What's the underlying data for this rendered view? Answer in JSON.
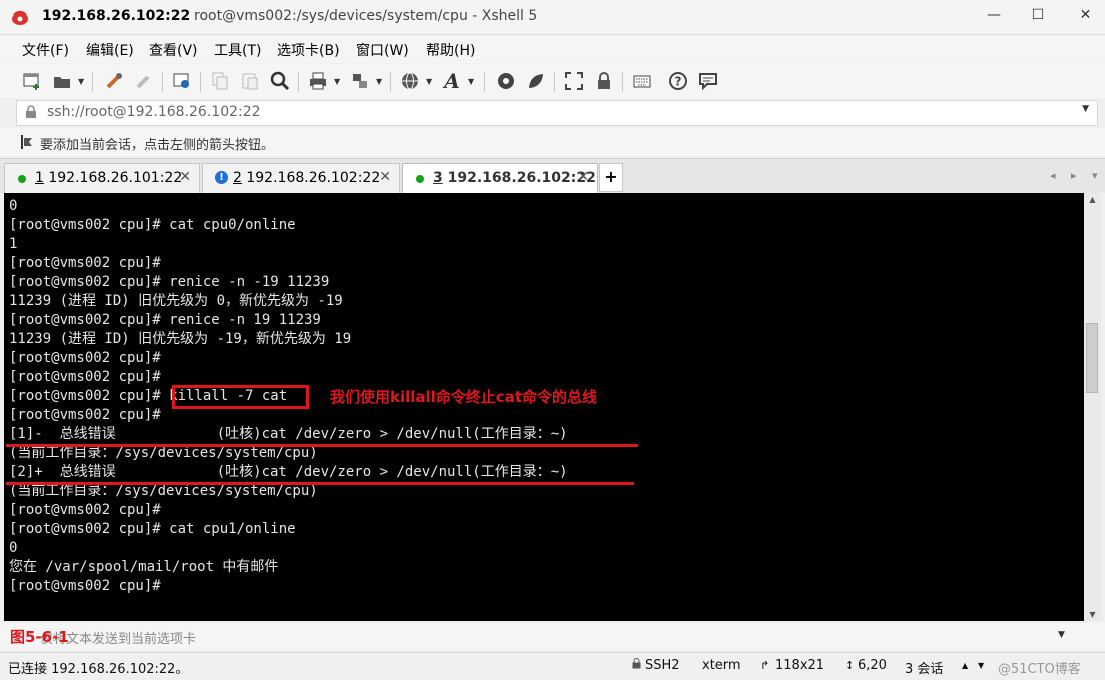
{
  "window": {
    "title_host": "192.168.26.102:22",
    "title_rest": "root@vms002:/sys/devices/system/cpu - Xshell 5",
    "controls": {
      "minimize": "—",
      "maximize": "☐",
      "close": "✕"
    }
  },
  "menu": [
    "文件(F)",
    "编辑(E)",
    "查看(V)",
    "工具(T)",
    "选项卡(B)",
    "窗口(W)",
    "帮助(H)"
  ],
  "toolbar": {
    "icons": [
      "new-session-icon",
      "open-folder-icon",
      "reconnect-icon",
      "disconnect-icon",
      "properties-icon",
      "copy-icon",
      "paste-icon",
      "find-icon",
      "print-icon",
      "transfer-icon",
      "globe-icon",
      "font-icon",
      "xftp-icon",
      "xmanager-icon",
      "fullscreen-icon",
      "lock-icon",
      "keyboard-icon",
      "help-icon",
      "chat-icon"
    ]
  },
  "address": {
    "value": "ssh://root@192.168.26.102:22"
  },
  "hint": {
    "text": "要添加当前会话，点击左侧的箭头按钮。"
  },
  "tabs": [
    {
      "num": "1",
      "label": " 192.168.26.101:22",
      "status": "connected"
    },
    {
      "num": "2",
      "label": " 192.168.26.102:22",
      "status": "alert"
    },
    {
      "num": "3",
      "label": " 192.168.26.102:22",
      "status": "connected",
      "active": true
    }
  ],
  "tab_add": "+",
  "tab_nav": "◂ ▸ ▾",
  "terminal": {
    "lines": [
      "0",
      "[root@vms002 cpu]# cat cpu0/online",
      "1",
      "[root@vms002 cpu]#",
      "[root@vms002 cpu]# renice -n -19 11239",
      "11239 (进程 ID) 旧优先级为 0，新优先级为 -19",
      "[root@vms002 cpu]# renice -n 19 11239",
      "11239 (进程 ID) 旧优先级为 -19，新优先级为 19",
      "[root@vms002 cpu]#",
      "[root@vms002 cpu]#",
      "[root@vms002 cpu]# killall -7 cat",
      "[root@vms002 cpu]#",
      "[1]-  总线错误            (吐核)cat /dev/zero > /dev/null(工作目录：~)",
      "(当前工作目录：/sys/devices/system/cpu)",
      "[2]+  总线错误            (吐核)cat /dev/zero > /dev/null(工作目录：~)",
      "(当前工作目录：/sys/devices/system/cpu)",
      "[root@vms002 cpu]#",
      "[root@vms002 cpu]# cat cpu1/online",
      "0",
      "您在 /var/spool/mail/root 中有邮件",
      "[root@vms002 cpu]#"
    ],
    "annotation": "我们使用killall命令终止cat命令的总线"
  },
  "compose": {
    "placeholder": "仅将文本发送到当前选项卡",
    "figure_label": "图5-6-1"
  },
  "status": {
    "connection": "已连接 192.168.26.102:22。",
    "protocol": "SSH2",
    "terminal_type": "xterm",
    "size": "118x21",
    "cursor": "6,20",
    "sessions": "3 会话",
    "watermark": "@51CTO博客"
  },
  "colors": {
    "accent_red": "#e0161d",
    "terminal_bg": "#000000",
    "terminal_fg": "#e6e6e6",
    "connected_green": "#18a018",
    "alert_blue": "#1e6fd0"
  }
}
